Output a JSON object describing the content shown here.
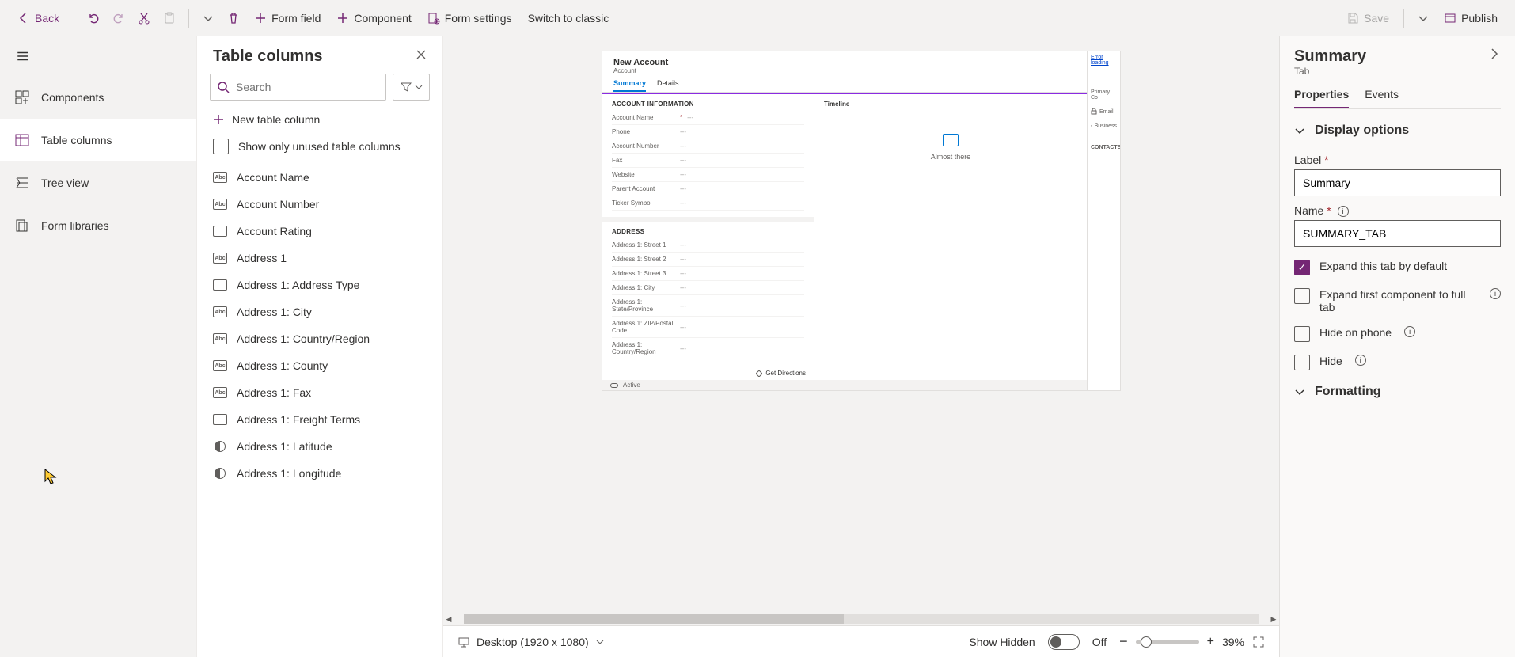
{
  "topbar": {
    "back": "Back",
    "form_field": "Form field",
    "component": "Component",
    "form_settings": "Form settings",
    "switch_classic": "Switch to classic",
    "save": "Save",
    "publish": "Publish"
  },
  "rail": {
    "items": [
      {
        "label": "Components"
      },
      {
        "label": "Table columns"
      },
      {
        "label": "Tree view"
      },
      {
        "label": "Form libraries"
      }
    ]
  },
  "panel": {
    "title": "Table columns",
    "search_placeholder": "Search",
    "new_column": "New table column",
    "show_unused": "Show only unused table columns",
    "columns": [
      {
        "label": "Account Name",
        "dt": "Abc"
      },
      {
        "label": "Account Number",
        "dt": "Abc"
      },
      {
        "label": "Account Rating",
        "dt": "box"
      },
      {
        "label": "Address 1",
        "dt": "Abcdef"
      },
      {
        "label": "Address 1: Address Type",
        "dt": "box"
      },
      {
        "label": "Address 1: City",
        "dt": "Abc"
      },
      {
        "label": "Address 1: Country/Region",
        "dt": "Abc"
      },
      {
        "label": "Address 1: County",
        "dt": "Abc"
      },
      {
        "label": "Address 1: Fax",
        "dt": "Abc"
      },
      {
        "label": "Address 1: Freight Terms",
        "dt": "box"
      },
      {
        "label": "Address 1: Latitude",
        "dt": "circle"
      },
      {
        "label": "Address 1: Longitude",
        "dt": "circle"
      }
    ]
  },
  "canvas": {
    "form_title": "New Account",
    "form_entity": "Account",
    "tabs": [
      {
        "label": "Summary",
        "active": true
      },
      {
        "label": "Details",
        "active": false
      }
    ],
    "section_account": "ACCOUNT INFORMATION",
    "fields_account": [
      {
        "label": "Account Name",
        "req": true
      },
      {
        "label": "Phone"
      },
      {
        "label": "Account Number"
      },
      {
        "label": "Fax"
      },
      {
        "label": "Website"
      },
      {
        "label": "Parent Account"
      },
      {
        "label": "Ticker Symbol"
      }
    ],
    "section_address": "ADDRESS",
    "fields_address": [
      {
        "label": "Address 1: Street 1"
      },
      {
        "label": "Address 1: Street 2"
      },
      {
        "label": "Address 1: Street 3"
      },
      {
        "label": "Address 1: City"
      },
      {
        "label": "Address 1: State/Province"
      },
      {
        "label": "Address 1: ZIP/Postal Code"
      },
      {
        "label": "Address 1: Country/Region"
      }
    ],
    "get_directions": "Get Directions",
    "timeline": "Timeline",
    "timeline_text": "Almost there",
    "active": "Active",
    "error_loading": "Error loading",
    "right_items": [
      {
        "label": "Primary Co"
      },
      {
        "label": "Email"
      },
      {
        "label": "Business"
      }
    ],
    "contacts": "CONTACTS"
  },
  "statusbar": {
    "device": "Desktop (1920 x 1080)",
    "show_hidden": "Show Hidden",
    "toggle": "Off",
    "zoom": "39%"
  },
  "props": {
    "title": "Summary",
    "subtitle": "Tab",
    "tabs": [
      {
        "label": "Properties",
        "active": true
      },
      {
        "label": "Events",
        "active": false
      }
    ],
    "section_display": "Display options",
    "label_field": "Label",
    "label_value": "Summary",
    "name_field": "Name",
    "name_value": "SUMMARY_TAB",
    "chk_expand_default": "Expand this tab by default",
    "chk_expand_first": "Expand first component to full tab",
    "chk_hide_phone": "Hide on phone",
    "chk_hide": "Hide",
    "section_formatting": "Formatting"
  }
}
